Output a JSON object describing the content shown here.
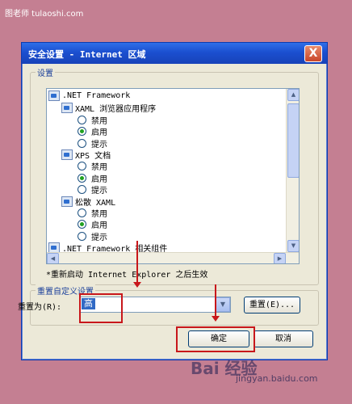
{
  "watermark": {
    "top": "图老师 tulaoshi.com",
    "baidu": "Bai 经验",
    "site": "jingyan.baidu.com"
  },
  "dialog": {
    "title": "安全设置 - Internet 区域",
    "close_label": "X",
    "settings_group_label": "设置",
    "tree": [
      {
        "kind": "folder",
        "label": ".NET Framework",
        "level": 0
      },
      {
        "kind": "folder",
        "label": "XAML 浏览器应用程序",
        "level": 1
      },
      {
        "kind": "radio",
        "label": "禁用",
        "checked": false,
        "level": 2
      },
      {
        "kind": "radio",
        "label": "启用",
        "checked": true,
        "level": 2
      },
      {
        "kind": "radio",
        "label": "提示",
        "checked": false,
        "level": 2
      },
      {
        "kind": "folder",
        "label": "XPS 文档",
        "level": 1
      },
      {
        "kind": "radio",
        "label": "禁用",
        "checked": false,
        "level": 2
      },
      {
        "kind": "radio",
        "label": "启用",
        "checked": true,
        "level": 2
      },
      {
        "kind": "radio",
        "label": "提示",
        "checked": false,
        "level": 2
      },
      {
        "kind": "folder",
        "label": "松散 XAML",
        "level": 1
      },
      {
        "kind": "radio",
        "label": "禁用",
        "checked": false,
        "level": 2
      },
      {
        "kind": "radio",
        "label": "启用",
        "checked": true,
        "level": 2
      },
      {
        "kind": "radio",
        "label": "提示",
        "checked": false,
        "level": 2
      },
      {
        "kind": "folder",
        "label": ".NET Framework 相关组件",
        "level": 0
      }
    ],
    "restart_note": "*重新启动 Internet Explorer 之后生效",
    "reset_group_label": "重置自定义设置",
    "reset_to_label": "重置为(R):",
    "reset_level_value": "高",
    "reset_button": "重置(E)...",
    "ok_button": "确定",
    "cancel_button": "取消"
  },
  "colors": {
    "background": "#c47f92",
    "titlebar": "#1b4fd0",
    "highlight_box": "#c8171b",
    "selection": "#316ac5"
  }
}
